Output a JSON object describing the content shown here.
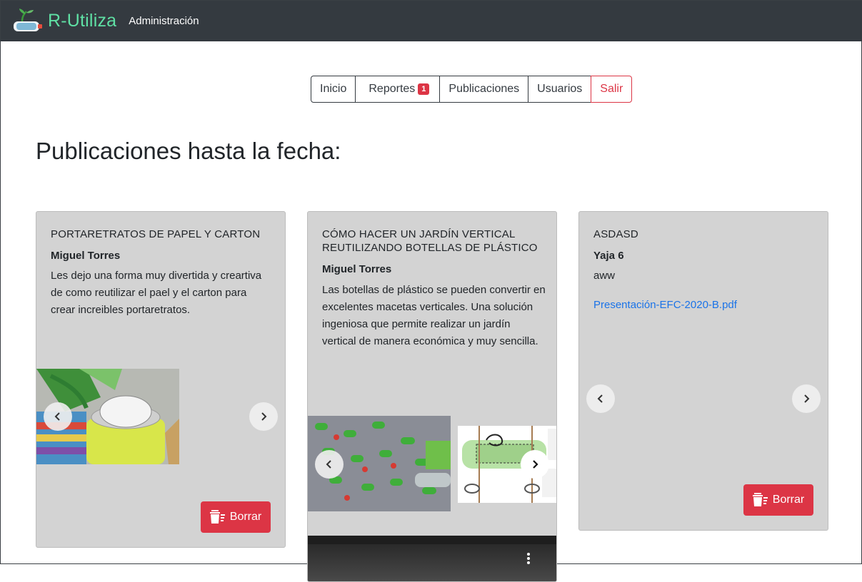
{
  "navbar": {
    "brand": "R-Utiliza",
    "admin_link": "Administración"
  },
  "menu": {
    "inicio": "Inicio",
    "reportes": "Reportes",
    "reportes_badge": "1",
    "publicaciones": "Publicaciones",
    "usuarios": "Usuarios",
    "salir": "Salir"
  },
  "page_title": "Publicaciones hasta la fecha:",
  "cards": [
    {
      "title": "PORTARETRATOS DE PAPEL Y CARTON",
      "author": "Miguel Torres",
      "text": "Les dejo una forma muy divertida y creartiva de como reutilizar el pael y el carton para crear increibles portaretratos.",
      "delete_label": "Borrar"
    },
    {
      "title": "CÓMO HACER UN JARDÍN VERTICAL REUTILIZANDO BOTELLAS DE PLÁSTICO",
      "author": "Miguel Torres",
      "text": "Las botellas de plástico se pueden convertir en excelentes macetas verticales. Una solución ingeniosa que permite realizar un jardín vertical de manera económica y muy sencilla."
    },
    {
      "title": "ASDASD",
      "author": "Yaja 6",
      "text": "aww",
      "attachment": "Presentación-EFC-2020-B.pdf",
      "delete_label": "Borrar"
    }
  ],
  "colors": {
    "navbar_bg": "#343a40",
    "brand": "#5fe0a4",
    "danger": "#dc3545",
    "card_bg": "#d3d3d3",
    "link": "#1a73e8"
  }
}
